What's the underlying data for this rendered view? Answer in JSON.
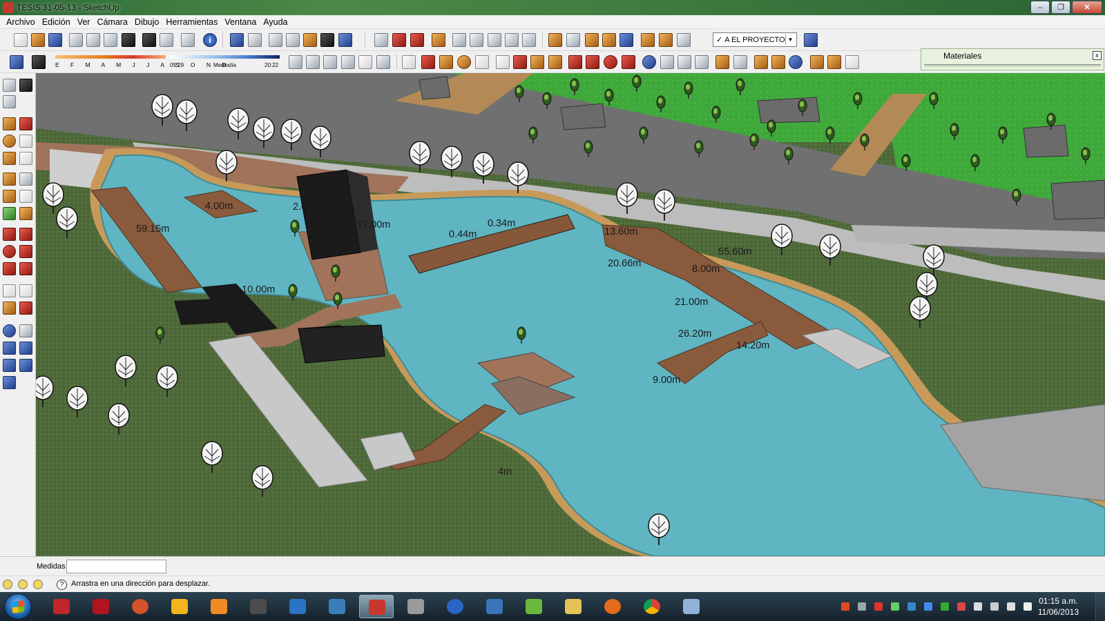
{
  "window": {
    "title": "TESIS 31-05-13 - SketchUp",
    "minimize_label": "‒",
    "maximize_label": "❐",
    "close_label": "✕"
  },
  "menu": [
    "Archivo",
    "Edición",
    "Ver",
    "Cámara",
    "Dibujo",
    "Herramientas",
    "Ventana",
    "Ayuda"
  ],
  "toolbar": {
    "layer_value": "A EL PROYECTO",
    "layer_check": "✓"
  },
  "shadow": {
    "months_label": "E F M A M J J A S O N D",
    "time_start": "05:29",
    "time_mid": "Mediodía",
    "time_end": "20:22"
  },
  "materials_panel": {
    "title": "Materiales",
    "close": "x"
  },
  "dimensions": [
    "59.15m",
    "13.60m",
    "55.60m",
    "20.66m",
    "8.00m",
    "21.00m",
    "26.20m",
    "14.20m",
    "9.00m",
    "10.00m",
    "0.44m",
    "0.34m",
    "17.00m",
    "4.00m",
    "2.00m",
    "4m"
  ],
  "measure": {
    "label": "Medidas",
    "value": ""
  },
  "status": {
    "hint": "Arrastra en una dirección para desplazar."
  },
  "clock": {
    "time": "01:15 a.m.",
    "date": "11/06/2013"
  },
  "colors": {
    "grass": "#4f6a3a",
    "water": "#5fb5c2",
    "deck": "#8a5a3c",
    "road": "#6e6e6e",
    "sand": "#c89a5a"
  }
}
